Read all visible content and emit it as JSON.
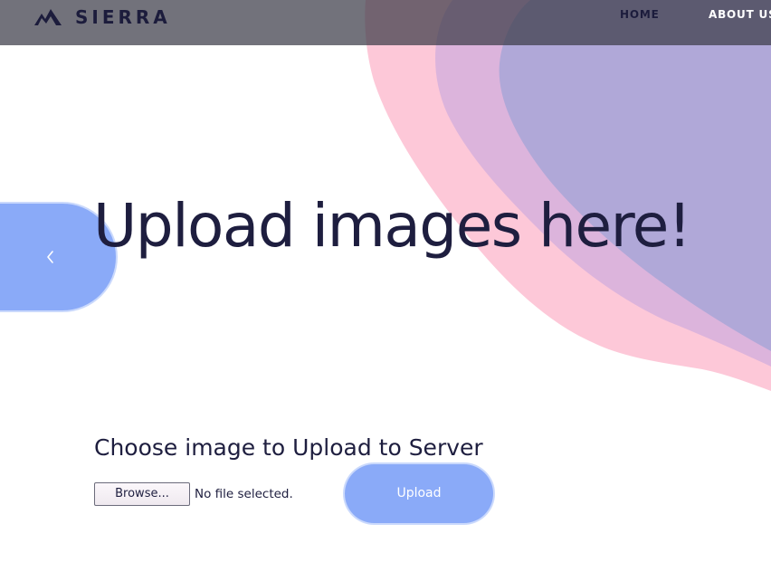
{
  "nav": {
    "brand": "SIERRA",
    "links": {
      "home": "HOME",
      "about": "ABOUT US"
    }
  },
  "hero": {
    "title": "Upload images here!",
    "prev_icon": "chevron-left-icon"
  },
  "upload": {
    "heading": "Choose image to Upload to Server",
    "browse_label": "Browse...",
    "file_status": "No file selected.",
    "submit_label": "Upload"
  },
  "colors": {
    "navbar": "#3c3c48",
    "brand_text": "#1c1c3c",
    "accent_blue": "#8aaaf8",
    "blob_pink": "#fdc8d8",
    "blob_mauve": "#dcb4dc",
    "blob_lavender": "#b0a8d8",
    "text_dark": "#1e1e3f"
  }
}
